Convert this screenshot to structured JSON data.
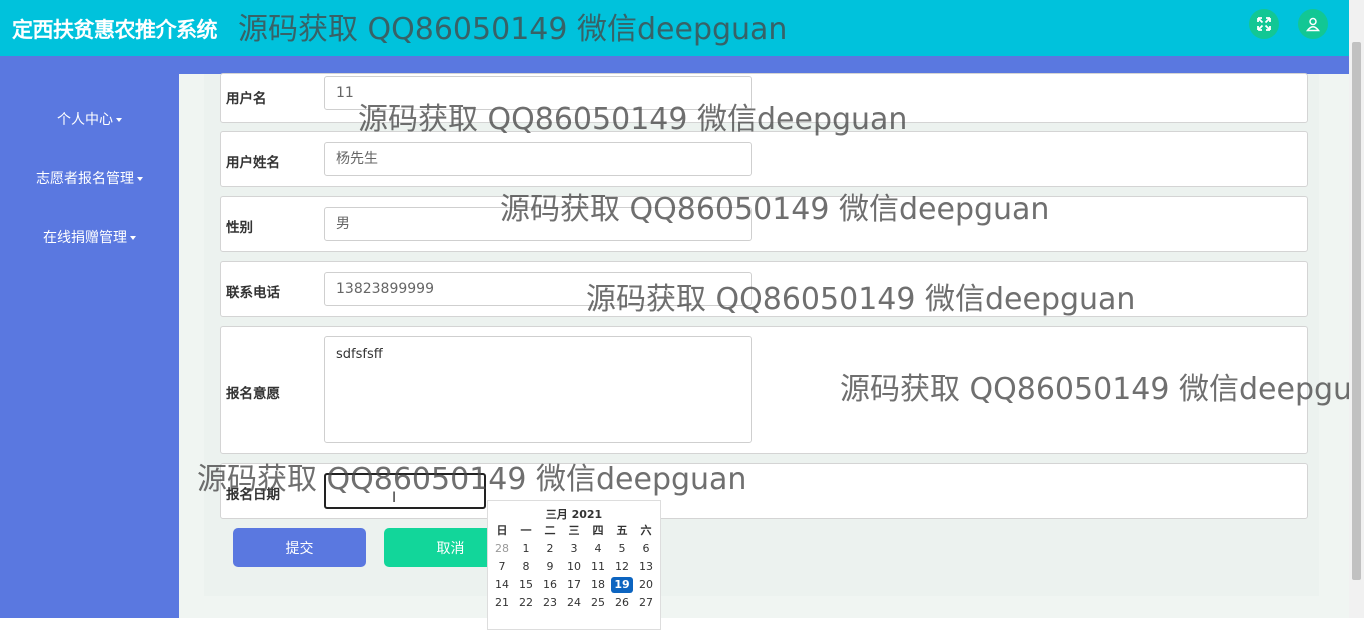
{
  "header": {
    "title": "定西扶贫惠农推介系统",
    "fullscreen_icon": "expand-icon",
    "user_icon": "user-icon"
  },
  "sidebar": {
    "items": [
      {
        "label": "个人中心"
      },
      {
        "label": "志愿者报名管理"
      },
      {
        "label": "在线捐赠管理"
      }
    ]
  },
  "form": {
    "username": {
      "label": "用户名",
      "value": "11"
    },
    "realname": {
      "label": "用户姓名",
      "value": "杨先生"
    },
    "gender": {
      "label": "性别",
      "value": "男"
    },
    "phone": {
      "label": "联系电话",
      "value": "13823899999"
    },
    "intent": {
      "label": "报名意愿",
      "value": "sdfsfsff"
    },
    "date": {
      "label": "报名日期",
      "value": ""
    }
  },
  "buttons": {
    "submit": "提交",
    "cancel": "取消"
  },
  "datepicker": {
    "title": "三月 2021",
    "weekdays": [
      "日",
      "一",
      "二",
      "三",
      "四",
      "五",
      "六"
    ],
    "weeks": [
      [
        "28",
        "1",
        "2",
        "3",
        "4",
        "5",
        "6"
      ],
      [
        "7",
        "8",
        "9",
        "10",
        "11",
        "12",
        "13"
      ],
      [
        "14",
        "15",
        "16",
        "17",
        "18",
        "19",
        "20"
      ],
      [
        "21",
        "22",
        "23",
        "24",
        "25",
        "26",
        "27"
      ]
    ],
    "selected": "19"
  },
  "watermark": "源码获取 QQ86050149 微信deepguan",
  "colors": {
    "header": "#00c2dc",
    "sidebar": "#5a78e0",
    "submit": "#5a78e0",
    "cancel": "#12d69a",
    "today": "#0c64c0"
  }
}
